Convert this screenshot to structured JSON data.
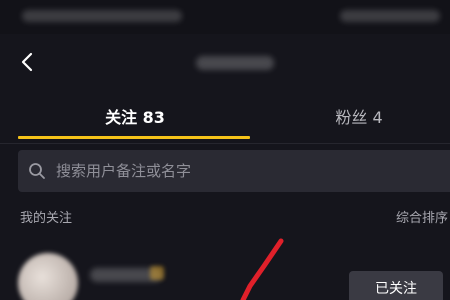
{
  "tabs": [
    {
      "label": "关注 83"
    },
    {
      "label": "粉丝 4"
    }
  ],
  "search": {
    "placeholder": "搜索用户备注或名字"
  },
  "section": {
    "title": "我的关注",
    "sort_label": "综合排序"
  },
  "user_row": {
    "action_label": "已关注"
  },
  "colors": {
    "background": "#15151c",
    "accent": "#f5c319",
    "search_bg": "#2a2a33",
    "button_bg": "#3a3a43",
    "annotation": "#e0202a"
  }
}
